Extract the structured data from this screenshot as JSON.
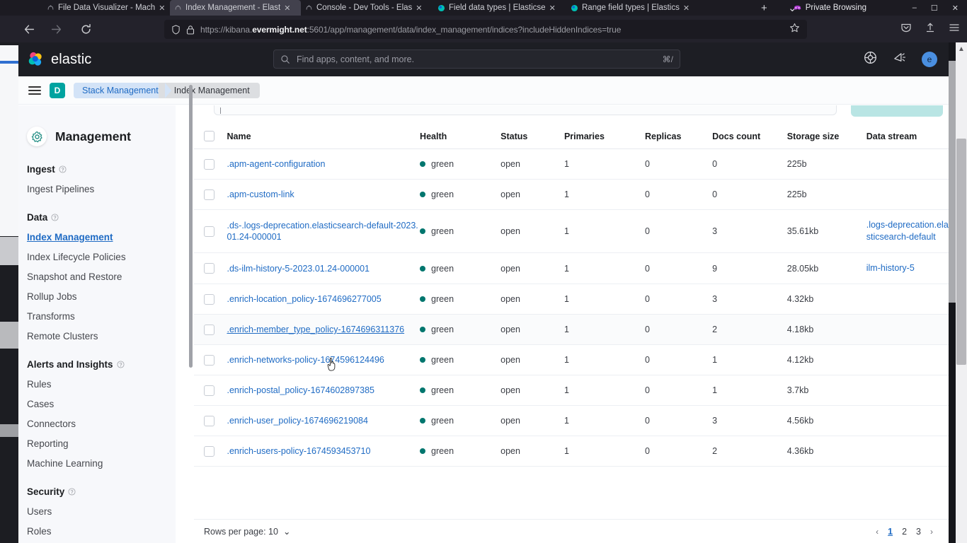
{
  "browser": {
    "tabs": [
      {
        "title": "File Data Visualizer - Mach",
        "close": "✕",
        "favicon": "kibana-icon",
        "active": false
      },
      {
        "title": "Index Management - Elast",
        "close": "✕",
        "favicon": "kibana-icon",
        "active": true
      },
      {
        "title": "Console - Dev Tools - Elas",
        "close": "✕",
        "favicon": "kibana-icon",
        "active": false
      },
      {
        "title": "Field data types | Elasticse",
        "close": "✕",
        "favicon": "elastic-icon",
        "active": false
      },
      {
        "title": "Range field types | Elastics",
        "close": "✕",
        "favicon": "elastic-icon",
        "active": false
      }
    ],
    "new_tab_label": "+",
    "tab_list_label": "⌄",
    "private_browsing_label": "Private Browsing",
    "window_buttons": [
      "–",
      "❐",
      "✕"
    ],
    "nav": {
      "back": "←",
      "forward": "→",
      "reload": "⟳",
      "shield_icon": "shield-icon",
      "lock_icon": "lock-icon",
      "url_prefix": "https://kibana.",
      "url_domain": "evermight.net",
      "url_suffix": ":5601/app/management/data/index_management/indices?includeHiddenIndices=true",
      "bookmark_icon": "star-icon",
      "pocket_icon": "pocket-icon",
      "share_icon": "share-icon",
      "menu_icon": "hamburger-menu-icon"
    }
  },
  "header": {
    "logo_text": "elastic",
    "search_placeholder": "Find apps, content, and more.",
    "search_shortcut": "⌘/",
    "help_icon": "help-icon",
    "whats_new_icon": "megaphone-icon",
    "avatar_initial": "e"
  },
  "breadcrumb": {
    "menu_icon": "hamburger-menu-icon",
    "space_initial": "D",
    "items": [
      {
        "label": "Stack Management"
      },
      {
        "label": "Index Management"
      }
    ]
  },
  "sidebar": {
    "title": "Management",
    "gear_icon": "gear-icon",
    "groups": [
      {
        "label": "Ingest",
        "info_icon": "info-icon",
        "items": [
          {
            "label": "Ingest Pipelines",
            "active": false
          }
        ]
      },
      {
        "label": "Data",
        "info_icon": "info-icon",
        "items": [
          {
            "label": "Index Management",
            "active": true
          },
          {
            "label": "Index Lifecycle Policies",
            "active": false
          },
          {
            "label": "Snapshot and Restore",
            "active": false
          },
          {
            "label": "Rollup Jobs",
            "active": false
          },
          {
            "label": "Transforms",
            "active": false
          },
          {
            "label": "Remote Clusters",
            "active": false
          }
        ]
      },
      {
        "label": "Alerts and Insights",
        "info_icon": "info-icon",
        "items": [
          {
            "label": "Rules",
            "active": false
          },
          {
            "label": "Cases",
            "active": false
          },
          {
            "label": "Connectors",
            "active": false
          },
          {
            "label": "Reporting",
            "active": false
          },
          {
            "label": "Machine Learning",
            "active": false
          }
        ]
      },
      {
        "label": "Security",
        "info_icon": "info-icon",
        "items": [
          {
            "label": "Users",
            "active": false
          },
          {
            "label": "Roles",
            "active": false
          }
        ]
      }
    ]
  },
  "table": {
    "columns": [
      "Name",
      "Health",
      "Status",
      "Primaries",
      "Replicas",
      "Docs count",
      "Storage size",
      "Data stream"
    ],
    "rows": [
      {
        "name": ".apm-agent-configuration",
        "health": "green",
        "status": "open",
        "primaries": "1",
        "replicas": "0",
        "docs_count": "0",
        "storage_size": "225b",
        "data_stream": "",
        "hovered": false
      },
      {
        "name": ".apm-custom-link",
        "health": "green",
        "status": "open",
        "primaries": "1",
        "replicas": "0",
        "docs_count": "0",
        "storage_size": "225b",
        "data_stream": "",
        "hovered": false
      },
      {
        "name": ".ds-.logs-deprecation.elasticsearch-default-2023.01.24-000001",
        "health": "green",
        "status": "open",
        "primaries": "1",
        "replicas": "0",
        "docs_count": "3",
        "storage_size": "35.61kb",
        "data_stream": ".logs-deprecation.elasticsearch-default",
        "hovered": false
      },
      {
        "name": ".ds-ilm-history-5-2023.01.24-000001",
        "health": "green",
        "status": "open",
        "primaries": "1",
        "replicas": "0",
        "docs_count": "9",
        "storage_size": "28.05kb",
        "data_stream": "ilm-history-5",
        "hovered": false
      },
      {
        "name": ".enrich-location_policy-1674696277005",
        "health": "green",
        "status": "open",
        "primaries": "1",
        "replicas": "0",
        "docs_count": "3",
        "storage_size": "4.32kb",
        "data_stream": "",
        "hovered": false
      },
      {
        "name": ".enrich-member_type_policy-1674696311376",
        "health": "green",
        "status": "open",
        "primaries": "1",
        "replicas": "0",
        "docs_count": "2",
        "storage_size": "4.18kb",
        "data_stream": "",
        "hovered": true
      },
      {
        "name": ".enrich-networks-policy-1674596124496",
        "health": "green",
        "status": "open",
        "primaries": "1",
        "replicas": "0",
        "docs_count": "1",
        "storage_size": "4.12kb",
        "data_stream": "",
        "hovered": false
      },
      {
        "name": ".enrich-postal_policy-1674602897385",
        "health": "green",
        "status": "open",
        "primaries": "1",
        "replicas": "0",
        "docs_count": "1",
        "storage_size": "3.7kb",
        "data_stream": "",
        "hovered": false
      },
      {
        "name": ".enrich-user_policy-1674696219084",
        "health": "green",
        "status": "open",
        "primaries": "1",
        "replicas": "0",
        "docs_count": "3",
        "storage_size": "4.56kb",
        "data_stream": "",
        "hovered": false
      },
      {
        "name": ".enrich-users-policy-1674593453710",
        "health": "green",
        "status": "open",
        "primaries": "1",
        "replicas": "0",
        "docs_count": "2",
        "storage_size": "4.36kb",
        "data_stream": "",
        "hovered": false
      }
    ]
  },
  "footer": {
    "rows_per_page_label": "Rows per page: 10",
    "rows_per_page_caret": "⌄",
    "prev_arrow": "‹",
    "next_arrow": "›",
    "pages": [
      "1",
      "2",
      "3"
    ],
    "current_page": "1"
  },
  "colors": {
    "link": "#1f6bc4",
    "health_green": "#00766e",
    "space_avatar": "#00a3a0",
    "reload_button": "#b9e5e4",
    "crumb_active": "#d3e3f7"
  }
}
